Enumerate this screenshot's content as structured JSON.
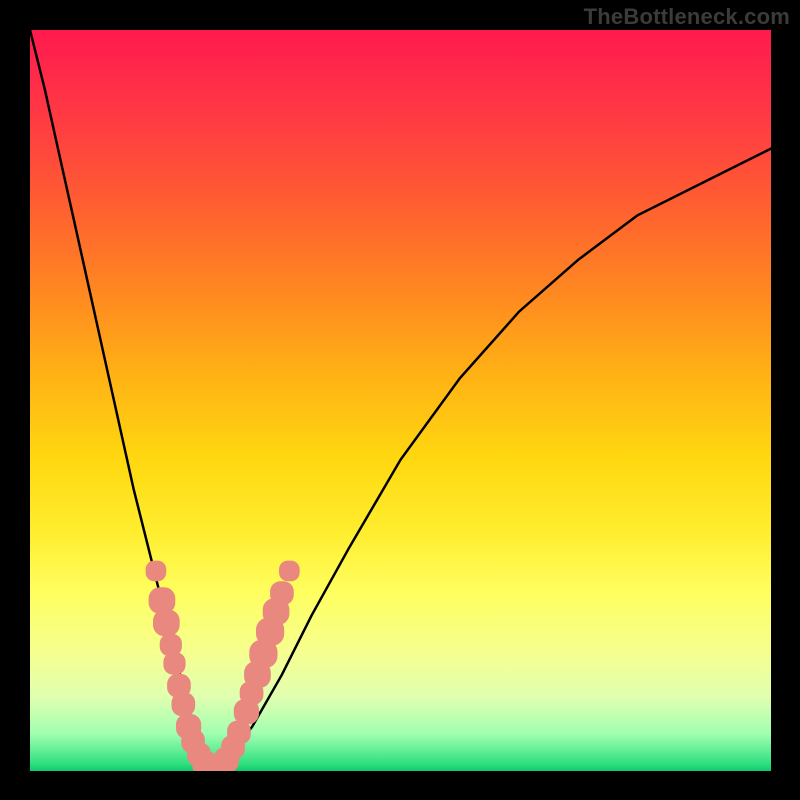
{
  "domain": "Chart",
  "watermark": "TheBottleneck.com",
  "colors": {
    "frame": "#000000",
    "curve": "#000000",
    "marker_fill": "#e9887f",
    "gradient_top": "#ff1a4d",
    "gradient_mid": "#ffd810",
    "gradient_bottom": "#10c870"
  },
  "chart_data": {
    "type": "line",
    "title": "",
    "xlabel": "",
    "ylabel": "",
    "xlim": [
      0,
      100
    ],
    "ylim": [
      0,
      100
    ],
    "grid": false,
    "legend": false,
    "note": "Axes are unlabeled in the source image; x/y are percentages of the plot box. y=0 is the bottom edge, y=100 the top edge.",
    "series": [
      {
        "name": "bottleneck-curve",
        "x": [
          0,
          2,
          4,
          6,
          8,
          10,
          12,
          14,
          16,
          18,
          20,
          21,
          22,
          23,
          24,
          25,
          27,
          30,
          34,
          38,
          43,
          50,
          58,
          66,
          74,
          82,
          90,
          96,
          100
        ],
        "y": [
          100,
          92,
          83,
          74,
          65,
          56,
          47,
          38,
          30,
          22,
          14,
          10,
          6,
          3,
          1,
          0,
          2,
          6,
          13,
          21,
          30,
          42,
          53,
          62,
          69,
          75,
          79,
          82,
          84
        ]
      }
    ],
    "markers": {
      "name": "highlighted-cluster",
      "note": "Scatter of rounded-rect markers clustered near the curve's minimum.",
      "points": [
        {
          "x": 17.0,
          "y": 27.0,
          "r": 1.4
        },
        {
          "x": 17.8,
          "y": 23.0,
          "r": 1.8
        },
        {
          "x": 18.4,
          "y": 20.0,
          "r": 1.8
        },
        {
          "x": 19.0,
          "y": 17.0,
          "r": 1.5
        },
        {
          "x": 19.5,
          "y": 14.5,
          "r": 1.5
        },
        {
          "x": 20.1,
          "y": 11.5,
          "r": 1.6
        },
        {
          "x": 20.7,
          "y": 9.0,
          "r": 1.6
        },
        {
          "x": 21.4,
          "y": 6.0,
          "r": 1.7
        },
        {
          "x": 22.0,
          "y": 4.0,
          "r": 1.6
        },
        {
          "x": 22.8,
          "y": 2.2,
          "r": 1.6
        },
        {
          "x": 23.6,
          "y": 1.0,
          "r": 1.7
        },
        {
          "x": 24.6,
          "y": 0.4,
          "r": 1.7
        },
        {
          "x": 25.6,
          "y": 0.5,
          "r": 1.7
        },
        {
          "x": 26.5,
          "y": 1.5,
          "r": 1.7
        },
        {
          "x": 27.4,
          "y": 3.2,
          "r": 1.6
        },
        {
          "x": 28.2,
          "y": 5.2,
          "r": 1.6
        },
        {
          "x": 29.2,
          "y": 8.0,
          "r": 1.7
        },
        {
          "x": 29.9,
          "y": 10.5,
          "r": 1.6
        },
        {
          "x": 30.7,
          "y": 13.0,
          "r": 1.8
        },
        {
          "x": 31.5,
          "y": 15.8,
          "r": 1.9
        },
        {
          "x": 32.4,
          "y": 18.8,
          "r": 1.9
        },
        {
          "x": 33.2,
          "y": 21.5,
          "r": 1.8
        },
        {
          "x": 34.0,
          "y": 24.0,
          "r": 1.6
        },
        {
          "x": 35.0,
          "y": 27.0,
          "r": 1.4
        }
      ]
    }
  }
}
